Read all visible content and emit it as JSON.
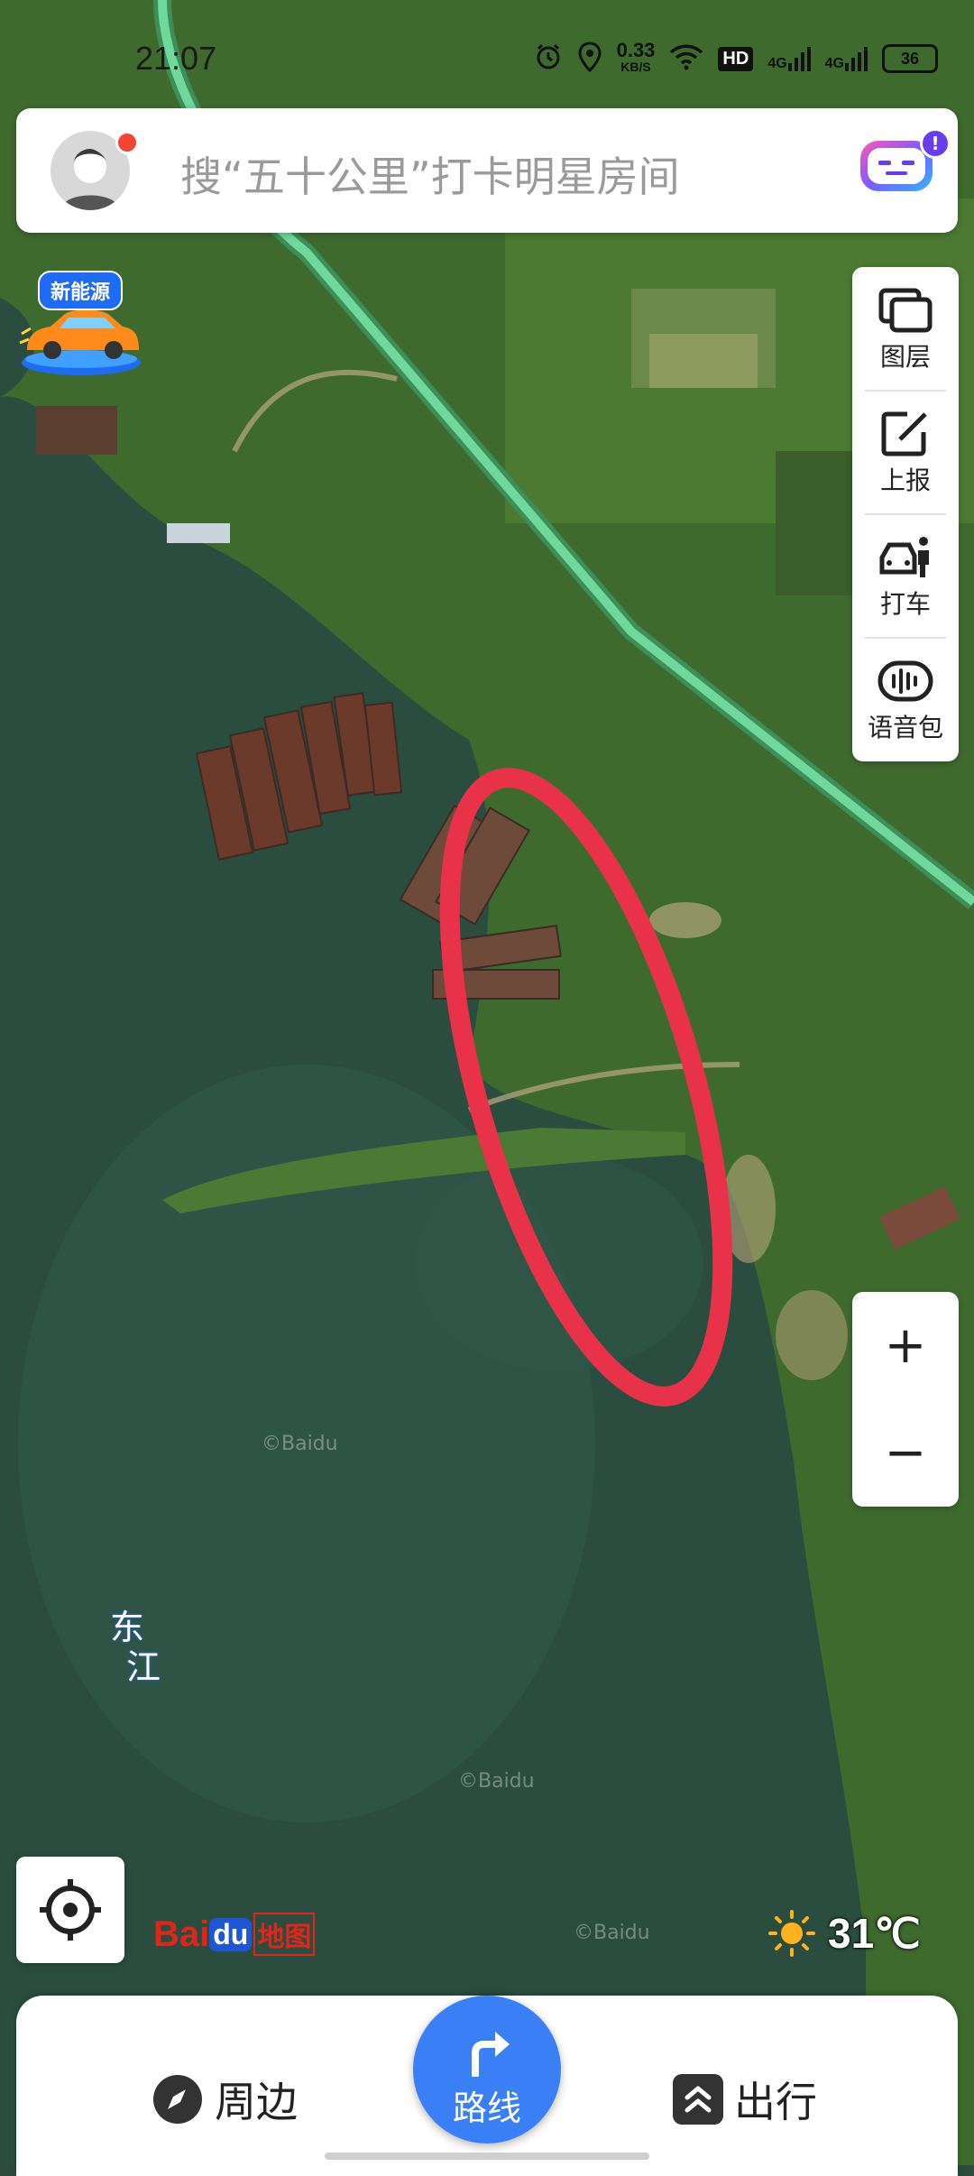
{
  "status_bar": {
    "time": "21:07",
    "net_speed_value": "0.33",
    "net_speed_unit": "KB/S",
    "hd_label": "HD",
    "signal_1": "4G",
    "signal_2": "4G",
    "battery": "36"
  },
  "search": {
    "placeholder": "搜“五十公里”打卡明星房间",
    "assistant_badge": "!"
  },
  "promo": {
    "new_energy_label": "新能源"
  },
  "tools": [
    {
      "label": "图层",
      "icon": "layers-icon"
    },
    {
      "label": "上报",
      "icon": "report-edit-icon"
    },
    {
      "label": "打车",
      "icon": "taxi-icon"
    },
    {
      "label": "语音包",
      "icon": "voice-pack-icon"
    }
  ],
  "zoom": {
    "in": "+",
    "out": "−"
  },
  "map": {
    "river_label": [
      "东",
      "江"
    ],
    "watermark": "©Baidu",
    "annotation_color": "#e8324a",
    "road_color": "#6fd89a"
  },
  "logo": {
    "bai": "Bai",
    "du": "du",
    "map": "地图"
  },
  "weather": {
    "temperature": "31℃",
    "icon": "sun-icon"
  },
  "bottom_bar": {
    "nearby_label": "周边",
    "route_label": "路线",
    "travel_label": "出行"
  }
}
